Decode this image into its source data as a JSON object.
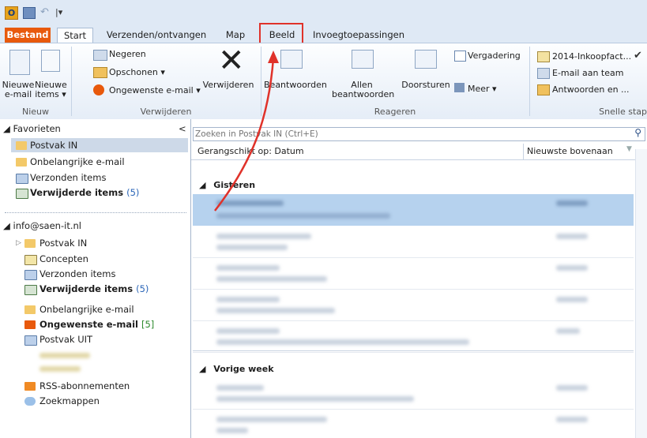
{
  "ribbon_tabs": [
    "Bestand",
    "Start",
    "Verzenden/ontvangen",
    "Map",
    "Beeld",
    "Invoegtoepassingen"
  ],
  "nieuw": {
    "email_1": "Nieuwe",
    "email_2": "e-mail",
    "items_1": "Nieuwe",
    "items_2": "items ▾",
    "group": "Nieuw"
  },
  "verwijderen": {
    "negeren": "Negeren",
    "opschonen": "Opschonen ▾",
    "ongewenst": "Ongewenste e-mail ▾",
    "verwijderen": "Verwijderen",
    "group": "Verwijderen"
  },
  "reageren": {
    "beantwoorden": "Beantwoorden",
    "allen_1": "Allen",
    "allen_2": "beantwoorden",
    "doorsturen": "Doorsturen",
    "vergadering": "Vergadering",
    "meer": "Meer ▾",
    "group": "Reageren"
  },
  "snelle": {
    "item1": "2014-Inkoopfact...",
    "item2": "E-mail aan team",
    "item3": "Antwoorden en ...",
    "group": "Snelle stap"
  },
  "nav": {
    "favorieten": "Favorieten",
    "fav_items": [
      "Postvak IN",
      "Onbelangrijke e-mail",
      "Verzonden items",
      "Verwijderde items"
    ],
    "fav_count": "(5)",
    "account": "info@saen-it.nl",
    "acc_items": [
      "Postvak IN",
      "Concepten",
      "Verzonden items",
      "Verwijderde items",
      "Onbelangrijke e-mail",
      "Ongewenste e-mail",
      "Postvak UIT",
      "RSS-abonnementen",
      "Zoekmappen"
    ],
    "acc_count1": "(5)",
    "acc_count2": "[5]",
    "collapse": "<"
  },
  "search": {
    "placeholder": "Zoeken in Postvak IN (Ctrl+E)"
  },
  "list": {
    "sort_by": "Gerangschikt op: Datum",
    "sort_order": "Nieuwste bovenaan",
    "group1": "Gisteren",
    "group2": "Vorige week"
  },
  "colors": {
    "highlight": "#e0322a",
    "selected_row": "#b6d2ee",
    "bestand": "#e8590c"
  }
}
